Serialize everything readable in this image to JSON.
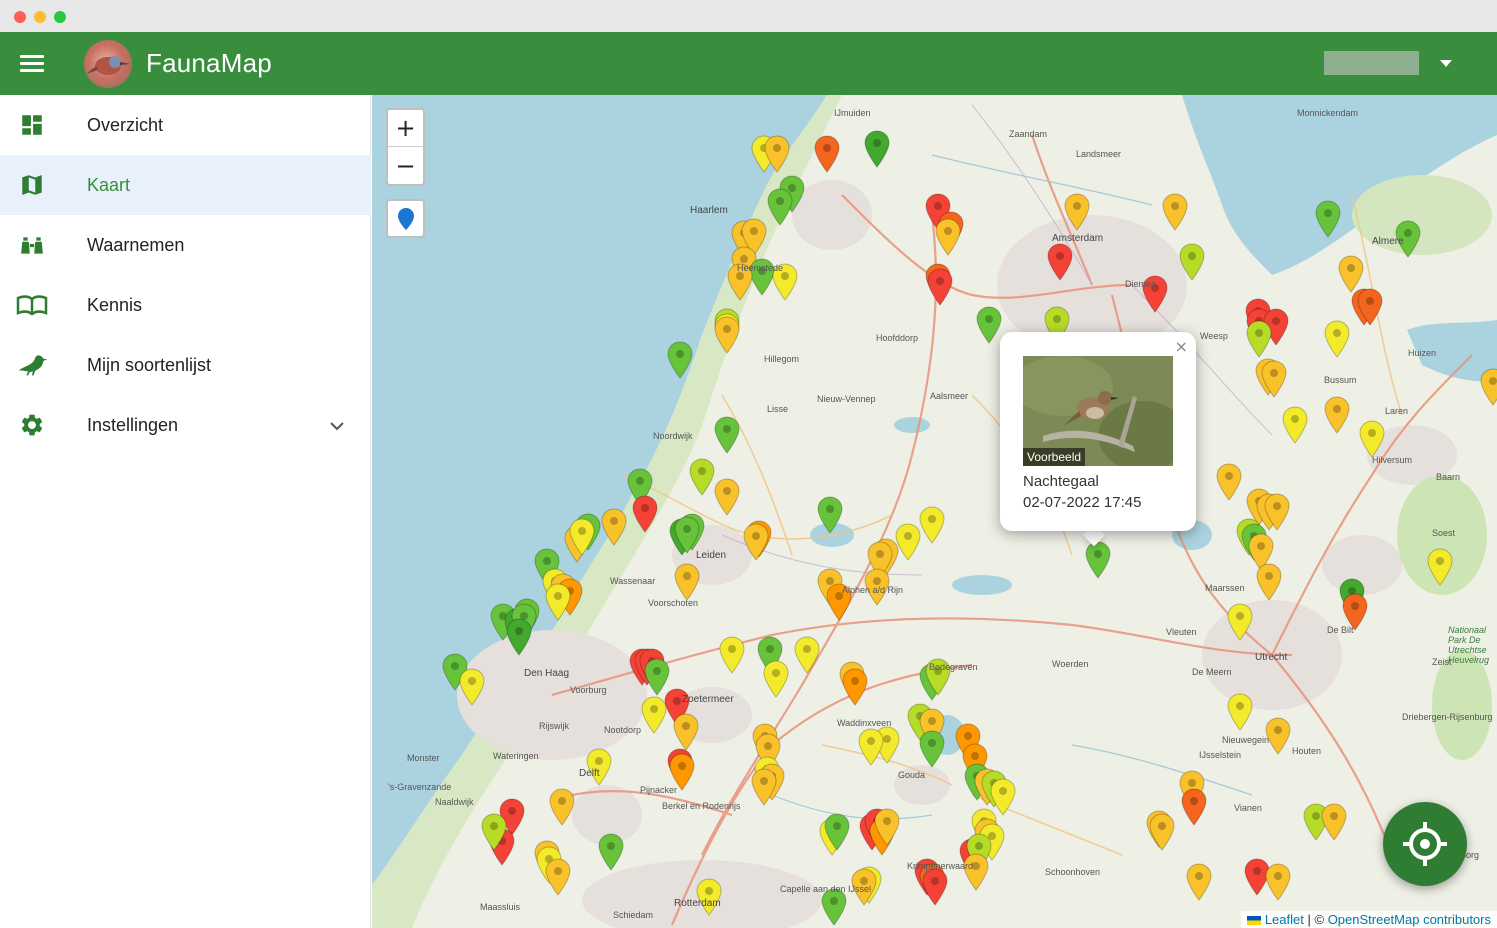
{
  "app": {
    "title": "FaunaMap"
  },
  "sidebar": {
    "items": [
      {
        "label": "Overzicht",
        "icon": "dashboard-icon"
      },
      {
        "label": "Kaart",
        "icon": "map-icon",
        "active": true
      },
      {
        "label": "Waarnemen",
        "icon": "binoculars-icon"
      },
      {
        "label": "Kennis",
        "icon": "book-icon"
      },
      {
        "label": "Mijn soortenlijst",
        "icon": "bird-icon"
      },
      {
        "label": "Instellingen",
        "icon": "gear-icon",
        "expandable": true
      }
    ]
  },
  "map": {
    "zoom_in": "+",
    "zoom_out": "−",
    "places": [
      "IJmuiden",
      "Zaandam",
      "Haarlem",
      "Amsterdam",
      "Almere",
      "Heemstede",
      "Hillegom",
      "Hoofddorp",
      "Aalsmeer",
      "Weesp",
      "Huizen",
      "Bussum",
      "Nieuw-Vennep",
      "Hilversum",
      "Noordwijk",
      "Leiden",
      "Wassenaar",
      "Alphen a/d Rijn",
      "Den Haag",
      "Zoetermeer",
      "Woerden",
      "Utrecht",
      "Gouda",
      "Delft",
      "Rijswijk",
      "Nootdorp",
      "Pijnacker",
      "Berkel en Rodenrijs",
      "Zeist",
      "Nieuwegein",
      "Houten",
      "Vianen",
      "Krimpenerwaard",
      "Schoonhoven",
      "Rotterdam",
      "Capelle aan den IJssel",
      "Schiedam",
      "Maassluis",
      "Wateringen",
      "Monster",
      "Naaldwijk",
      "Waddinxveen",
      "Bodegraven",
      "De Meern",
      "Maarssen",
      "De Bilt",
      "Baarn",
      "Soest",
      "Driebergen-Rijsenburg",
      "IJsselstein",
      "Culemborg",
      "Landsmeer",
      "Monnickendam",
      "Diemen",
      "Laren",
      "Vleuten",
      "Lisse",
      "Voorschoten",
      "Voorburg",
      "'s-Gravenzande",
      "Nationaal Park De Utrechtse Heuvelrug"
    ],
    "markers_colors": [
      "#f44336",
      "#f4651e",
      "#ff9800",
      "#f9c22b",
      "#f2ea2a",
      "#b6dc28",
      "#66c33a",
      "#43a92e"
    ]
  },
  "popup": {
    "image_badge": "Voorbeeld",
    "species": "Nachtegaal",
    "datetime": "02-07-2022 17:45",
    "close": "×"
  },
  "attribution": {
    "leaflet": "Leaflet",
    "separator": "| ©",
    "osm": "OpenStreetMap contributors"
  }
}
